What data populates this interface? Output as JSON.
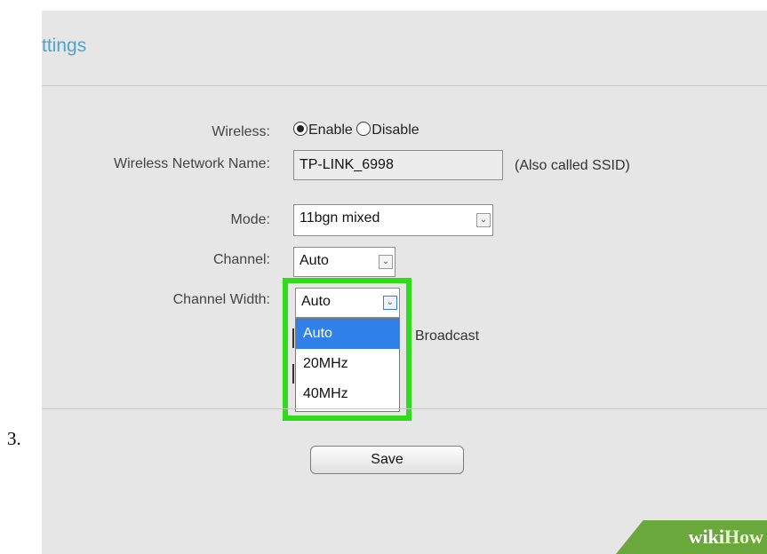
{
  "step_number": "3.",
  "page": {
    "title": "ttings"
  },
  "form": {
    "wireless": {
      "label": "Wireless:",
      "enable_label": "Enable",
      "disable_label": "Disable",
      "selected": "Enable"
    },
    "ssid": {
      "label": "Wireless Network Name:",
      "value": "TP-LINK_6998",
      "hint": "(Also called SSID)"
    },
    "mode": {
      "label": "Mode:",
      "value": "11bgn mixed"
    },
    "channel": {
      "label": "Channel:",
      "value": "Auto"
    },
    "channel_width": {
      "label": "Channel Width:",
      "value": "Auto",
      "options": [
        "Auto",
        "20MHz",
        "40MHz"
      ],
      "selected_option": "Auto"
    },
    "broadcast_text": "Broadcast"
  },
  "actions": {
    "save_label": "Save"
  },
  "watermark": {
    "wiki": "wiki",
    "how": "How"
  },
  "colors": {
    "highlight": "#2fdc1c",
    "title": "#4ba3cf",
    "selected_option": "#2f80e8",
    "watermark": "#6aa83c"
  },
  "icons": {
    "dropdown_arrow": "chevron-down-icon"
  }
}
